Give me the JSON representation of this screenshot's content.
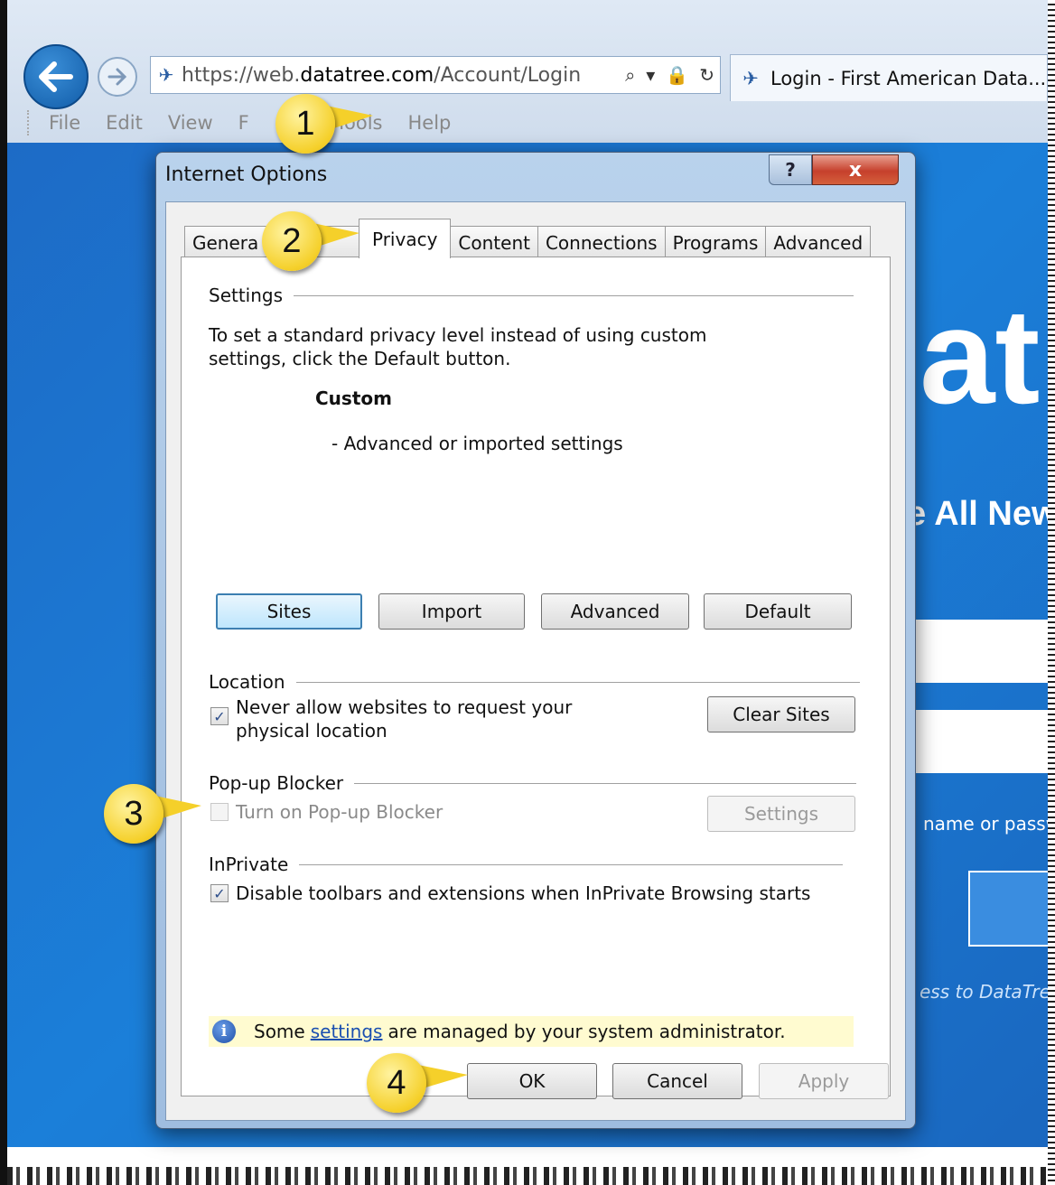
{
  "browser": {
    "url_prefix": "https://web.",
    "url_domain": "datatree.com",
    "url_path": "/Account/Login",
    "tab_title": "Login - First American Data...",
    "menu": [
      "File",
      "Edit",
      "View",
      "F",
      "Tools",
      "Help"
    ]
  },
  "page": {
    "big_text": "at",
    "all_new": "e All New",
    "hint": "name or passw",
    "access": "ess to DataTree"
  },
  "dialog": {
    "title": "Internet Options",
    "help_glyph": "?",
    "close_glyph": "x",
    "tabs": [
      "Genera",
      "Privacy",
      "Content",
      "Connections",
      "Programs",
      "Advanced"
    ],
    "settings_group": "Settings",
    "settings_desc_1": "To set a standard privacy level instead of using custom",
    "settings_desc_2": "settings, click the Default button.",
    "level_name": "Custom",
    "level_desc": "- Advanced or imported settings",
    "buttons_row": [
      "Sites",
      "Import",
      "Advanced",
      "Default"
    ],
    "location_group": "Location",
    "location_check_1": "Never allow websites to request your",
    "location_check_2": "physical location",
    "location_checked": true,
    "clear_sites": "Clear Sites",
    "popup_group": "Pop-up Blocker",
    "popup_check": "Turn on Pop-up Blocker",
    "popup_checked": false,
    "popup_settings": "Settings",
    "inprivate_group": "InPrivate",
    "inprivate_check": "Disable toolbars and extensions when InPrivate Browsing starts",
    "inprivate_checked": true,
    "info_pre": "Some",
    "info_link": "settings",
    "info_post": "are managed by your system administrator.",
    "ok": "OK",
    "cancel": "Cancel",
    "apply": "Apply"
  },
  "callouts": [
    "1",
    "2",
    "3",
    "4"
  ],
  "colors": {
    "callout": "#f5d02a",
    "page_blue": "#1b7fd9",
    "dialog_frame": "#a8c4e3",
    "info_bar": "#fffbd0"
  }
}
